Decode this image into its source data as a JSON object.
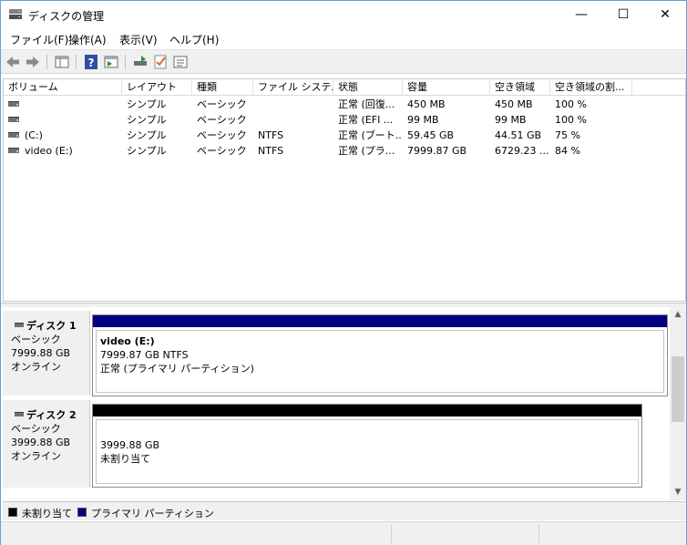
{
  "window": {
    "title": "ディスクの管理"
  },
  "window_controls": {
    "minimize": "—",
    "maximize": "☐",
    "close": "✕"
  },
  "menu": [
    {
      "label": "ファイル(F)"
    },
    {
      "label": "操作(A)"
    },
    {
      "label": "表示(V)"
    },
    {
      "label": "ヘルプ(H)"
    }
  ],
  "toolbar": {
    "icons": [
      "back-icon",
      "forward-icon",
      "console-tree-icon",
      "help-icon",
      "action-pane-icon",
      "rescan-disks-icon",
      "checklist-icon",
      "properties-icon"
    ]
  },
  "volume_list": {
    "columns": [
      "ボリューム",
      "レイアウト",
      "種類",
      "ファイル システム",
      "状態",
      "容量",
      "空き領域",
      "空き領域の割..."
    ],
    "rows": [
      {
        "volume": "",
        "layout": "シンプル",
        "type": "ベーシック",
        "fs": "",
        "status": "正常 (回復...",
        "capacity": "450 MB",
        "free": "450 MB",
        "pct": "100 %"
      },
      {
        "volume": "",
        "layout": "シンプル",
        "type": "ベーシック",
        "fs": "",
        "status": "正常 (EFI ...",
        "capacity": "99 MB",
        "free": "99 MB",
        "pct": "100 %"
      },
      {
        "volume": "(C:)",
        "layout": "シンプル",
        "type": "ベーシック",
        "fs": "NTFS",
        "status": "正常 (ブート...",
        "capacity": "59.45 GB",
        "free": "44.51 GB",
        "pct": "75 %"
      },
      {
        "volume": "video (E:)",
        "layout": "シンプル",
        "type": "ベーシック",
        "fs": "NTFS",
        "status": "正常 (プラ...",
        "capacity": "7999.87 GB",
        "free": "6729.23 ...",
        "pct": "84 %"
      }
    ]
  },
  "disks": [
    {
      "name": "ディスク 1",
      "type": "ベーシック",
      "size": "7999.88 GB",
      "state": "オンライン",
      "partition": {
        "title": "video  (E:)",
        "line1": "7999.87 GB NTFS",
        "line2": "正常 (プライマリ パーティション)",
        "bar_color": "#000080"
      }
    },
    {
      "name": "ディスク 2",
      "type": "ベーシック",
      "size": "3999.88 GB",
      "state": "オンライン",
      "partition": {
        "title": "",
        "line1": "3999.88 GB",
        "line2": "未割り当て",
        "bar_color": "#000000"
      }
    }
  ],
  "legend": [
    {
      "label": "未割り当て",
      "color": "#000000"
    },
    {
      "label": "プライマリ パーティション",
      "color": "#000080"
    }
  ],
  "scrollbar": {
    "up": "▲",
    "down": "▼"
  }
}
